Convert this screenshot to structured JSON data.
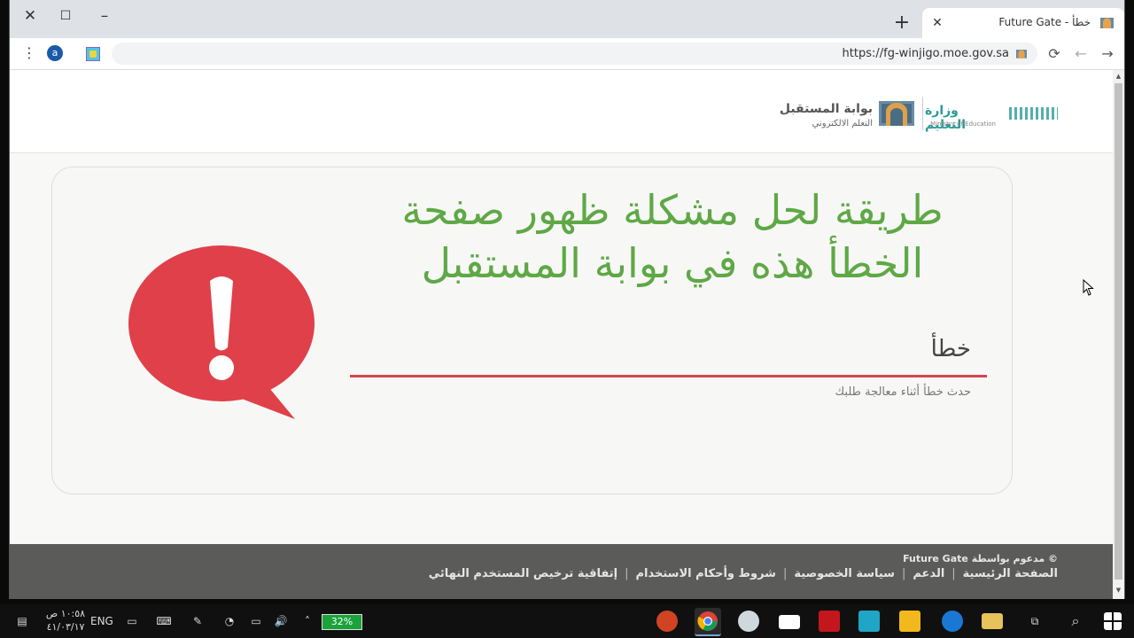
{
  "browser": {
    "tab": {
      "title": "Future Gate - خطأ"
    },
    "new_tab": "+",
    "url": "https://fg-winjigo.moe.gov.sa",
    "ext_label": "a"
  },
  "site": {
    "ministry_ar": "وزارة التعليم",
    "ministry_en": "Ministry of Education",
    "gate_title": "بوابة المستقبل",
    "gate_subtitle": "التعلم الالكتروني"
  },
  "overlay": {
    "line1": "طريقة لحل مشكلة ظهور صفحة",
    "line2": "الخطأ هذه في بوابة المستقبل"
  },
  "error": {
    "title": "خطأ",
    "message": "حدث خطأ أثناء معالجة طلبك"
  },
  "footer": {
    "credit": "© مدعوم بواسطة Future Gate",
    "links": [
      "الصفحة الرئيسية",
      "الدعم",
      "سياسة الخصوصية",
      "شروط وأحكام الاستخدام",
      "إتفاقية ترخيص المستخدم النهائي"
    ]
  },
  "taskbar": {
    "time": "١٠:٥٨ ص",
    "date": "٤١/٠٣/١٧",
    "language": "ENG",
    "battery": "32%"
  },
  "colors": {
    "accent_red": "#d9434b",
    "overlay_green": "#5fa846",
    "footer_bg": "#5b5b59",
    "moe_teal": "#2a9a96"
  }
}
